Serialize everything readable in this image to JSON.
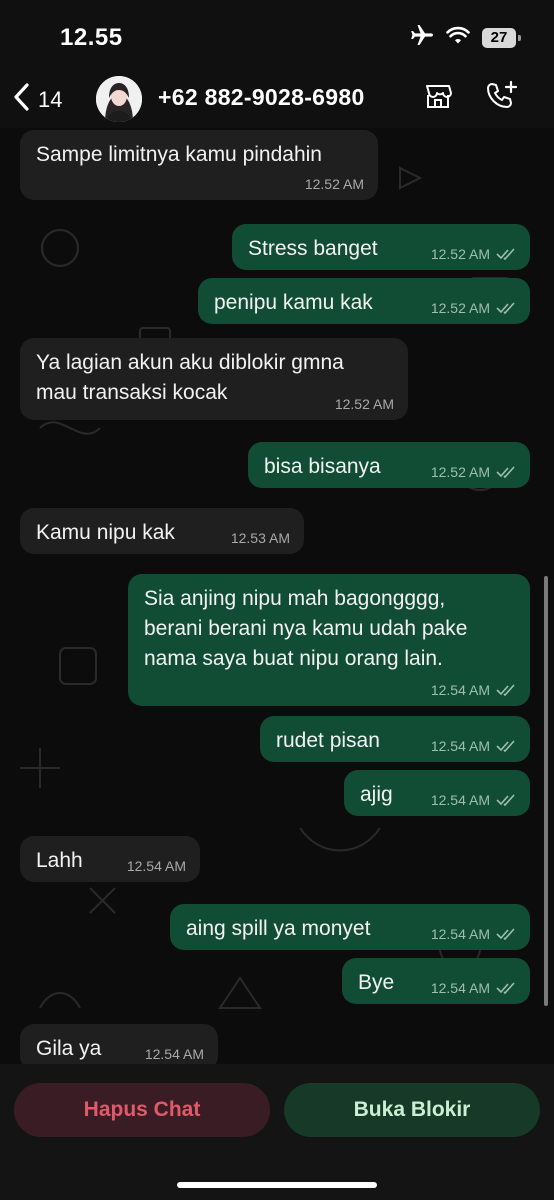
{
  "status_bar": {
    "time": "12.55",
    "battery": "27"
  },
  "header": {
    "back_count": "14",
    "contact": "+62 882-9028-6980"
  },
  "messages": [
    {
      "dir": "in",
      "text": "Sampe limitnya kamu pindahin",
      "time": "12.52 AM"
    },
    {
      "dir": "out",
      "text": "Stress banget",
      "time": "12.52 AM"
    },
    {
      "dir": "out",
      "text": "penipu kamu kak",
      "time": "12.52 AM"
    },
    {
      "dir": "in",
      "text": "Ya lagian akun aku diblokir gmna\nmau transaksi kocak",
      "time": "12.52 AM"
    },
    {
      "dir": "out",
      "text": "bisa bisanya",
      "time": "12.52 AM"
    },
    {
      "dir": "in",
      "text": "Kamu nipu kak",
      "time": "12.53 AM"
    },
    {
      "dir": "out",
      "text": "Sia anjing nipu mah bagongggg,\nberani berani nya kamu udah pake\nnama saya buat nipu orang lain.",
      "time": "12.54 AM"
    },
    {
      "dir": "out",
      "text": "rudet pisan",
      "time": "12.54 AM"
    },
    {
      "dir": "out",
      "text": "ajig",
      "time": "12.54 AM"
    },
    {
      "dir": "in",
      "text": "Lahh",
      "time": "12.54 AM"
    },
    {
      "dir": "out",
      "text": "aing spill ya monyet",
      "time": "12.54 AM"
    },
    {
      "dir": "out",
      "text": "Bye",
      "time": "12.54 AM"
    },
    {
      "dir": "in",
      "text": "Gila ya",
      "time": "12.54 AM"
    }
  ],
  "actions": {
    "delete_label": "Hapus Chat",
    "unblock_label": "Buka Blokir"
  },
  "colors": {
    "incoming": "#1f1f1f",
    "outgoing": "#114d35",
    "danger": "#e15a6a",
    "accent": "#c8f0d2"
  }
}
